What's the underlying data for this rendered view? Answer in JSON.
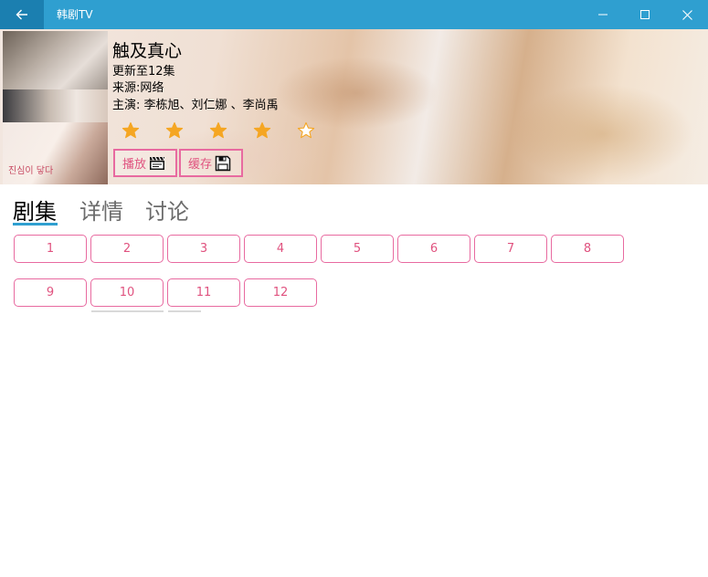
{
  "window": {
    "title": "韩剧TV",
    "accent": "#2f9fd0"
  },
  "show": {
    "title": "触及真心",
    "update": "更新至12集",
    "source": "来源:网络",
    "cast": "主演: 李栋旭、刘仁娜 、李尚禹",
    "rating": 4,
    "rating_max": 5,
    "poster_text": "진심이 닿다"
  },
  "actions": {
    "play_label": "播放",
    "play_icon": "clapperboard-icon",
    "cache_label": "缓存",
    "cache_icon": "floppy-disk-icon"
  },
  "tabs": [
    {
      "label": "剧集",
      "active": true
    },
    {
      "label": "详情",
      "active": false
    },
    {
      "label": "讨论",
      "active": false
    }
  ],
  "episodes": [
    "1",
    "2",
    "3",
    "4",
    "5",
    "6",
    "7",
    "8",
    "9",
    "10",
    "11",
    "12"
  ],
  "colors": {
    "pink": "#e86aa0",
    "star": "#f5a623"
  }
}
